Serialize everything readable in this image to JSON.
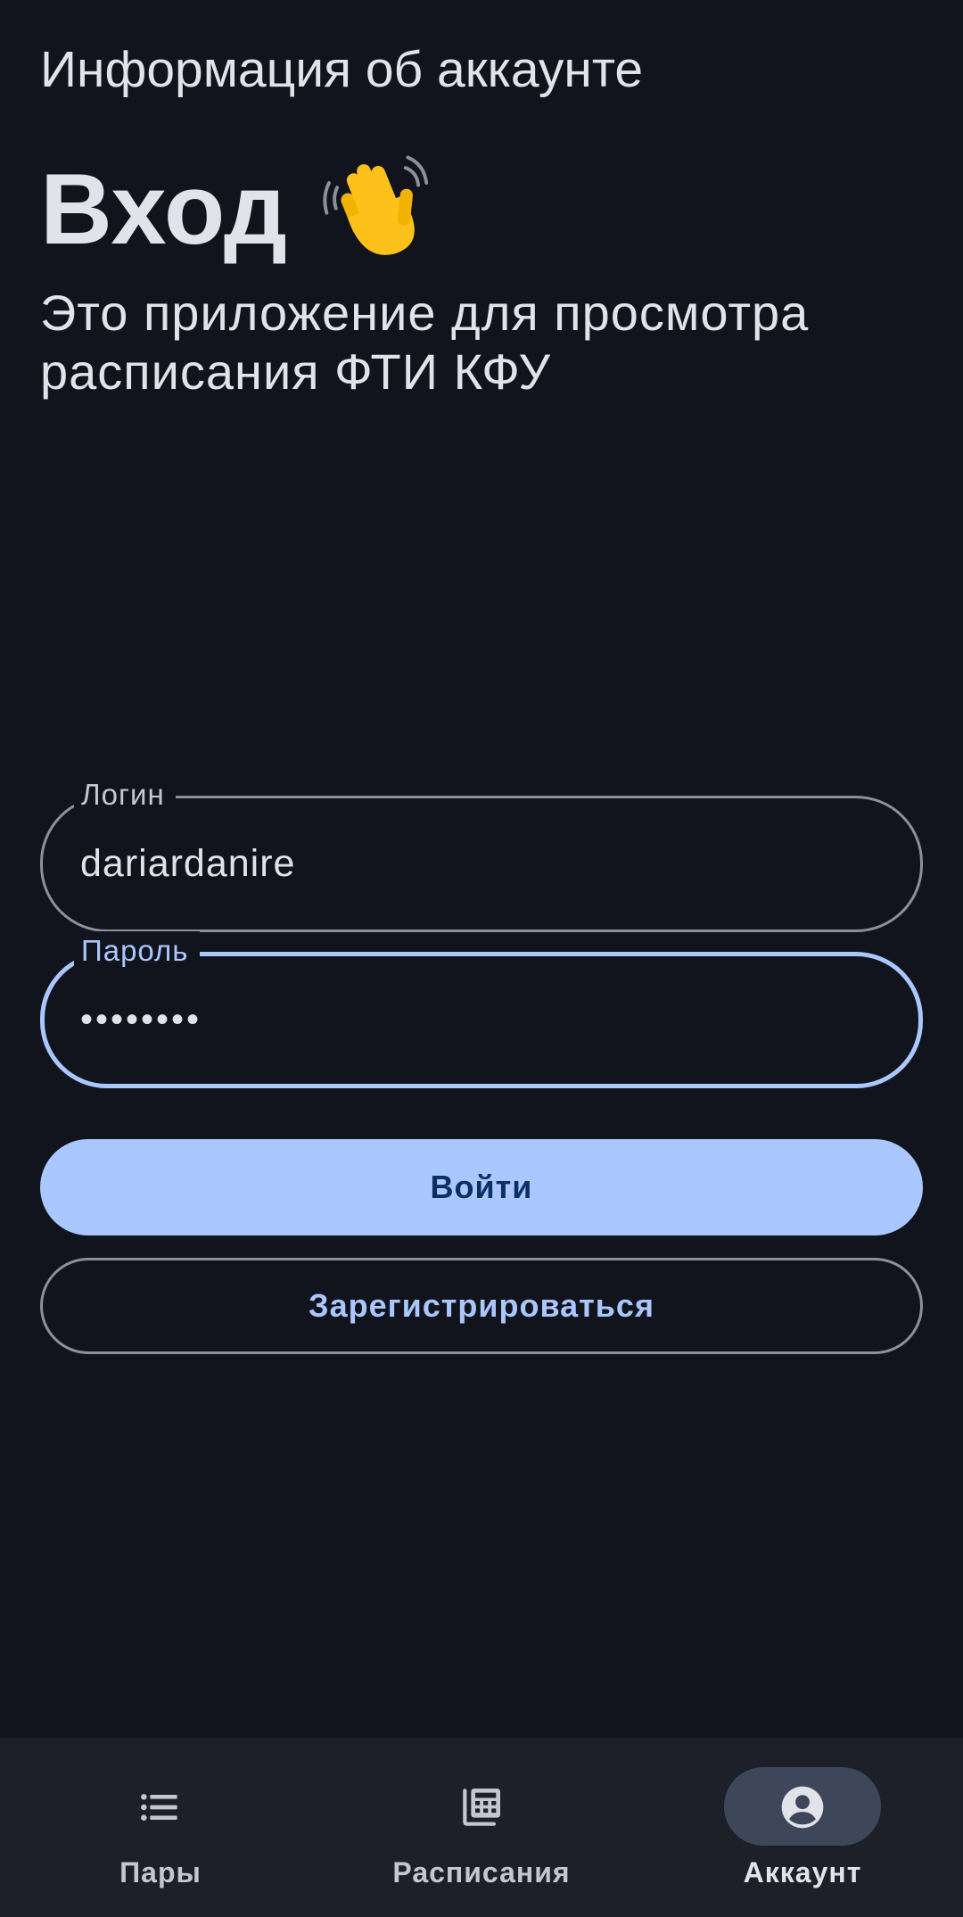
{
  "app_bar": {
    "title": "Информация об аккаунте"
  },
  "login_screen": {
    "heading": "Вход",
    "heading_icon": "waving-hand-icon",
    "subtitle": "Это приложение для просмотра расписания ФТИ КФУ",
    "login_field": {
      "label": "Логин",
      "value": "dariardanire"
    },
    "password_field": {
      "label": "Пароль",
      "value": "••••••••"
    },
    "login_button": "Войти",
    "register_button": "Зарегистрироваться"
  },
  "bottom_nav": {
    "items": [
      {
        "label": "Пары",
        "icon": "list-icon",
        "active": false
      },
      {
        "label": "Расписания",
        "icon": "calendar-grid-icon",
        "active": false
      },
      {
        "label": "Аккаунт",
        "icon": "account-circle-icon",
        "active": true
      }
    ]
  },
  "colors": {
    "background": "#11141c",
    "primary": "#aac7ff",
    "on_primary": "#0a305f",
    "nav_background": "#1d2029",
    "nav_indicator": "#3e4759",
    "outline": "#8e9099"
  }
}
